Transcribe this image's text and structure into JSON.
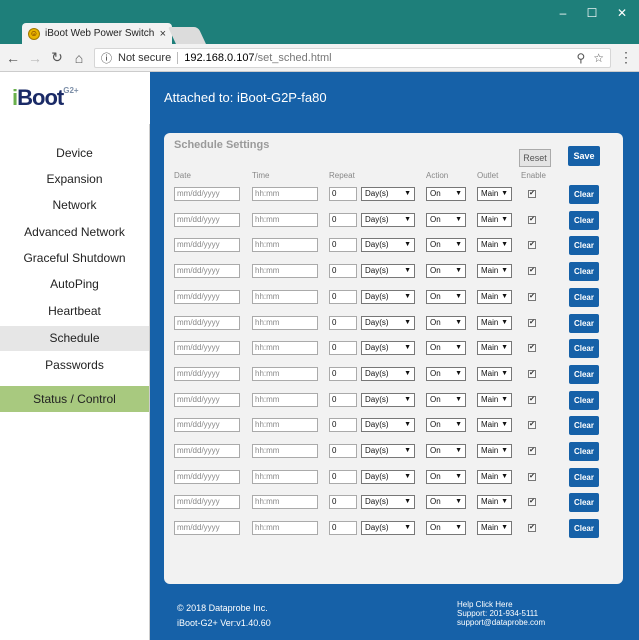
{
  "browser": {
    "tab_title": "iBoot Web Power Switch",
    "tab_close": "×",
    "security_label": "Not secure",
    "url_host": "192.168.0.107",
    "url_path": "/set_sched.html",
    "window_controls": [
      "–",
      "☐",
      "✕"
    ]
  },
  "header": {
    "logo_i": "i",
    "logo_text": "Boot",
    "logo_sup": "G2+",
    "attached": "Attached to: iBoot-G2P-fa80"
  },
  "sidebar": {
    "items": [
      {
        "label": "Device"
      },
      {
        "label": "Expansion"
      },
      {
        "label": "Network"
      },
      {
        "label": "Advanced Network"
      },
      {
        "label": "Graceful Shutdown"
      },
      {
        "label": "AutoPing"
      },
      {
        "label": "Heartbeat"
      },
      {
        "label": "Schedule"
      },
      {
        "label": "Passwords"
      }
    ],
    "active": "Schedule",
    "status_control": "Status / Control"
  },
  "schedule": {
    "title": "Schedule Settings",
    "reset_label": "Reset",
    "save_label": "Save",
    "columns": {
      "date": "Date",
      "time": "Time",
      "repeat": "Repeat",
      "action": "Action",
      "outlet": "Outlet",
      "enable": "Enable"
    },
    "date_placeholder": "mm/dd/yyyy",
    "time_placeholder": "hh:mm",
    "clear_label": "Clear",
    "rows": [
      {
        "repeat": "0",
        "unit": "Day(s)",
        "action": "On",
        "outlet": "Main",
        "enabled": true
      },
      {
        "repeat": "0",
        "unit": "Day(s)",
        "action": "On",
        "outlet": "Main",
        "enabled": true
      },
      {
        "repeat": "0",
        "unit": "Day(s)",
        "action": "On",
        "outlet": "Main",
        "enabled": true
      },
      {
        "repeat": "0",
        "unit": "Day(s)",
        "action": "On",
        "outlet": "Main",
        "enabled": true
      },
      {
        "repeat": "0",
        "unit": "Day(s)",
        "action": "On",
        "outlet": "Main",
        "enabled": true
      },
      {
        "repeat": "0",
        "unit": "Day(s)",
        "action": "On",
        "outlet": "Main",
        "enabled": true
      },
      {
        "repeat": "0",
        "unit": "Day(s)",
        "action": "On",
        "outlet": "Main",
        "enabled": true
      },
      {
        "repeat": "0",
        "unit": "Day(s)",
        "action": "On",
        "outlet": "Main",
        "enabled": true
      },
      {
        "repeat": "0",
        "unit": "Day(s)",
        "action": "On",
        "outlet": "Main",
        "enabled": true
      },
      {
        "repeat": "0",
        "unit": "Day(s)",
        "action": "On",
        "outlet": "Main",
        "enabled": true
      },
      {
        "repeat": "0",
        "unit": "Day(s)",
        "action": "On",
        "outlet": "Main",
        "enabled": true
      },
      {
        "repeat": "0",
        "unit": "Day(s)",
        "action": "On",
        "outlet": "Main",
        "enabled": true
      },
      {
        "repeat": "0",
        "unit": "Day(s)",
        "action": "On",
        "outlet": "Main",
        "enabled": true
      },
      {
        "repeat": "0",
        "unit": "Day(s)",
        "action": "On",
        "outlet": "Main",
        "enabled": true
      }
    ]
  },
  "footer": {
    "copyright": "© 2018 Dataprobe Inc.",
    "version": "iBoot-G2+ Ver:v1.40.60",
    "help": "Help Click Here",
    "support_phone": "Support: 201-934-5111",
    "support_email": "support@dataprobe.com"
  },
  "colors": {
    "brand_blue": "#1661a8",
    "titlebar_teal": "#1e7f7a",
    "status_green": "#a8c97f"
  }
}
